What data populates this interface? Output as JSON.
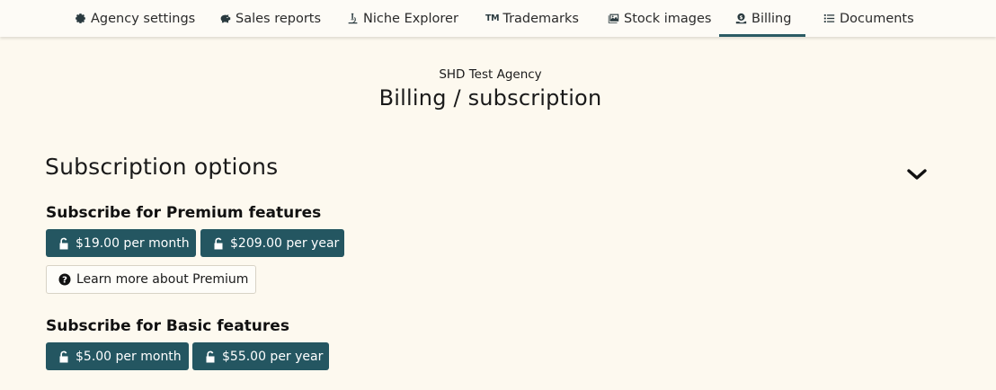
{
  "nav": {
    "items": [
      {
        "label": "Agency settings",
        "icon": "gear-icon"
      },
      {
        "label": "Sales reports",
        "icon": "piggy-bank-icon"
      },
      {
        "label": "Niche Explorer",
        "icon": "microscope-icon"
      },
      {
        "label": "Trademarks",
        "icon": "trademark-icon",
        "icon_text": "TM"
      },
      {
        "label": "Stock images",
        "icon": "images-icon"
      },
      {
        "label": "Billing",
        "icon": "money-hand-icon",
        "active": true
      },
      {
        "label": "Documents",
        "icon": "list-icon"
      }
    ]
  },
  "header": {
    "agency": "SHD Test Agency",
    "title": "Billing / subscription"
  },
  "subscription": {
    "title": "Subscription options",
    "premium": {
      "heading": "Subscribe for Premium features",
      "monthly": "$19.00 per month",
      "yearly": "$209.00 per year",
      "learn_more": "Learn more about Premium"
    },
    "basic": {
      "heading": "Subscribe for Basic features",
      "monthly": "$5.00 per month",
      "yearly": "$55.00 per year"
    }
  },
  "colors": {
    "background": "#fdf9ef",
    "accent": "#245661",
    "active_underline": "#2a5a63"
  }
}
